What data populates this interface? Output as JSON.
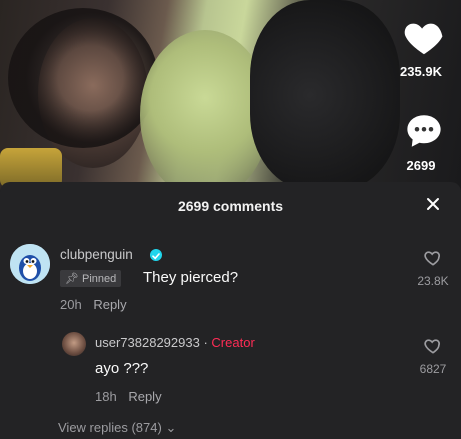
{
  "video": {
    "likes": "235.9K",
    "comments": "2699"
  },
  "sheet": {
    "title": "2699 comments"
  },
  "comments": [
    {
      "username": "clubpenguin",
      "pinned_label": "Pinned",
      "text": "They pierced?",
      "time": "20h",
      "reply_label": "Reply",
      "likes": "23.8K"
    }
  ],
  "reply": {
    "username": "user73828292933",
    "separator": "·",
    "creator_label": "Creator",
    "text": "ayo ???",
    "time": "18h",
    "reply_label": "Reply",
    "likes": "6827"
  },
  "view_replies": "View replies (874)",
  "colors": {
    "accent": "#fe2c55",
    "verified": "#20d5ec",
    "sheet_bg": "#232325"
  }
}
